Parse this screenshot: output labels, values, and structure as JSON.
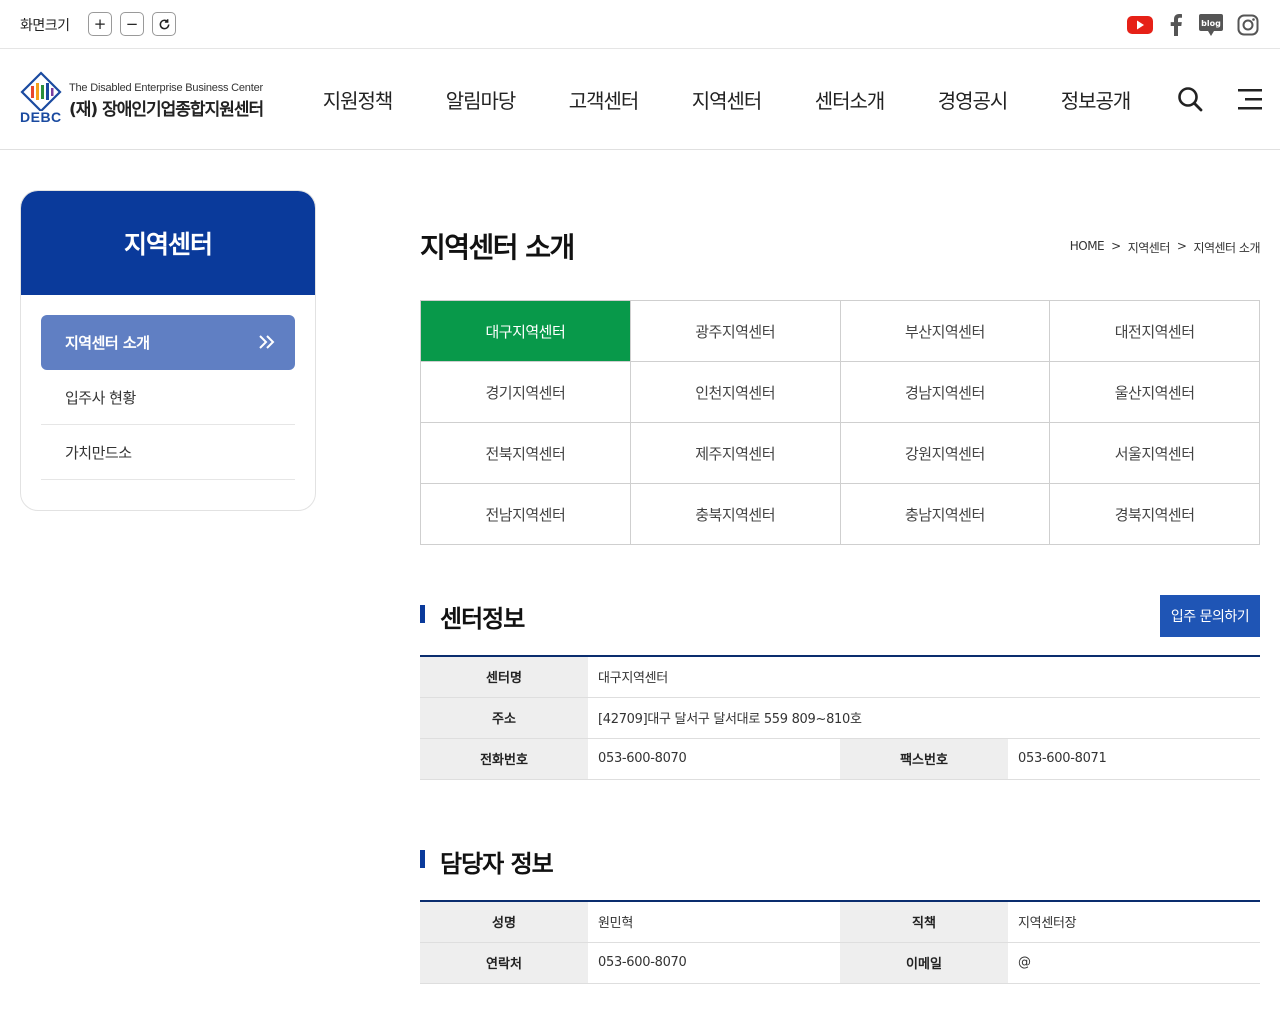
{
  "utility": {
    "zoom_label": "화면크기",
    "zoom_in": "+",
    "zoom_out": "−",
    "social": [
      "youtube-icon",
      "facebook-icon",
      "blog-icon",
      "instagram-icon"
    ],
    "blog_text": "blog"
  },
  "logo": {
    "english": "The Disabled Enterprise Business Center",
    "korean": "(재) 장애인기업종합지원센터",
    "abbr": "DEBC"
  },
  "nav": [
    "지원정책",
    "알림마당",
    "고객센터",
    "지역센터",
    "센터소개",
    "경영공시",
    "정보공개"
  ],
  "sidebar": {
    "title": "지역센터",
    "items": [
      {
        "label": "지역센터 소개",
        "active": true
      },
      {
        "label": "입주사 현황",
        "active": false
      },
      {
        "label": "가치만드소",
        "active": false
      }
    ]
  },
  "page": {
    "title": "지역센터 소개",
    "breadcrumb": [
      "HOME",
      ">",
      "지역센터",
      ">",
      "지역센터 소개"
    ]
  },
  "centers": [
    "대구지역센터",
    "광주지역센터",
    "부산지역센터",
    "대전지역센터",
    "경기지역센터",
    "인천지역센터",
    "경남지역센터",
    "울산지역센터",
    "전북지역센터",
    "제주지역센터",
    "강원지역센터",
    "서울지역센터",
    "전남지역센터",
    "충북지역센터",
    "충남지역센터",
    "경북지역센터"
  ],
  "selected_center": "대구지역센터",
  "colors": {
    "primary": "#0a3a9b",
    "selected": "#08994a",
    "button": "#1f55b5"
  },
  "center_info": {
    "section_title": "센터정보",
    "inquiry_button": "입주 문의하기",
    "name_label": "센터명",
    "name_value": "대구지역센터",
    "address_label": "주소",
    "address_value": "[42709]대구 달서구 달서대로 559 809~810호",
    "phone_label": "전화번호",
    "phone_value": "053-600-8070",
    "fax_label": "팩스번호",
    "fax_value": "053-600-8071"
  },
  "manager_info": {
    "section_title": "담당자 정보",
    "name_label": "성명",
    "name_value": "원민혁",
    "position_label": "직책",
    "position_value": "지역센터장",
    "contact_label": "연락처",
    "contact_value": "053-600-8070",
    "email_label": "이메일",
    "email_value": "@"
  }
}
